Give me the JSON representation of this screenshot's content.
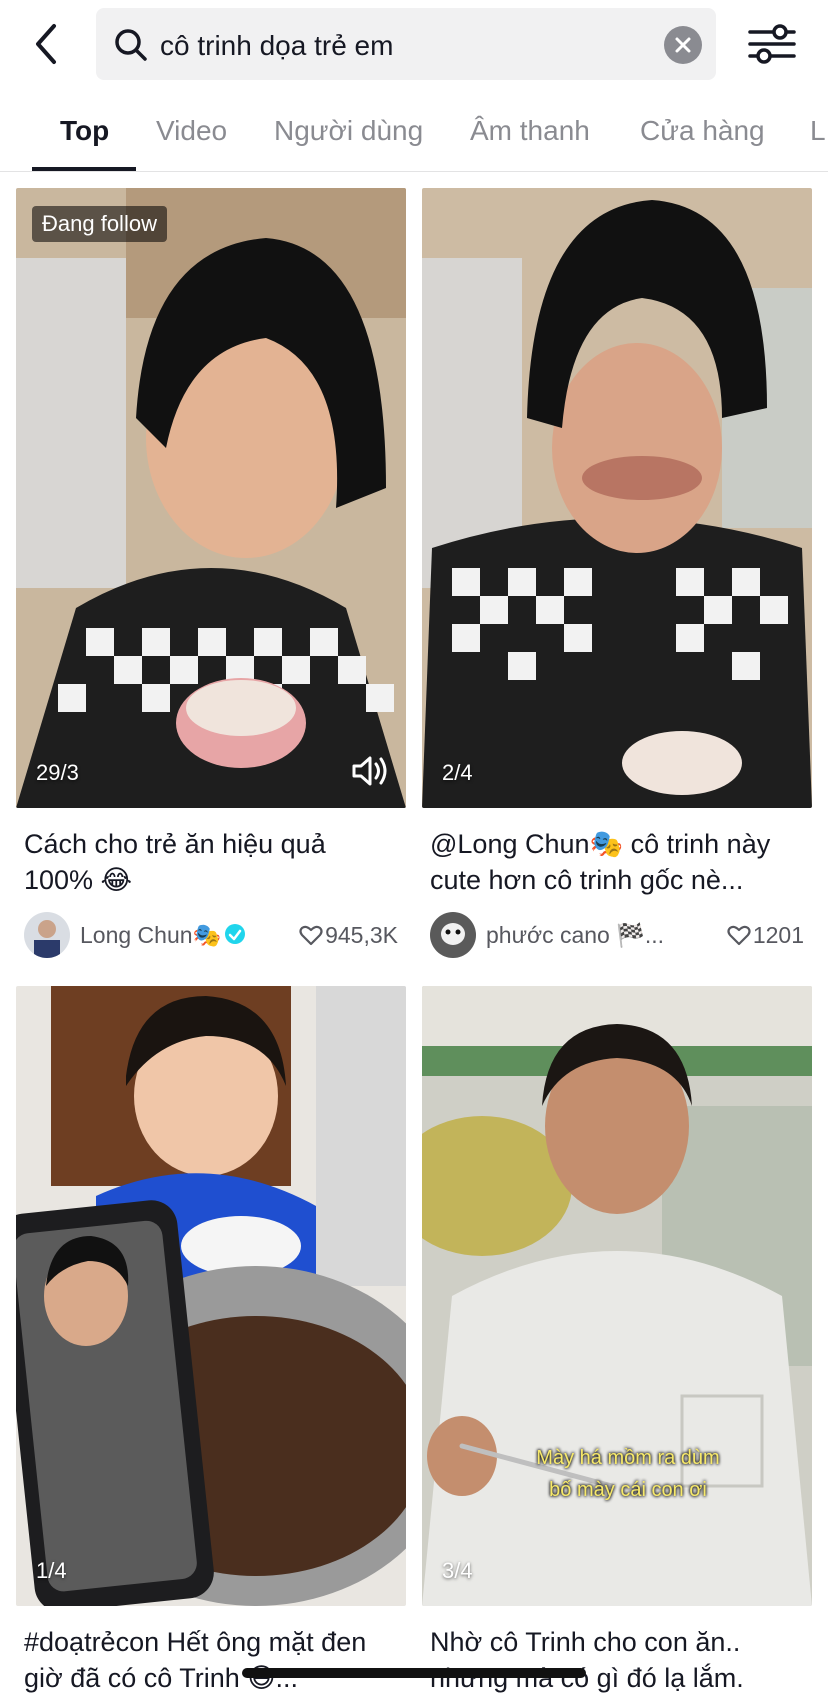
{
  "search": {
    "query": "cô trinh dọa trẻ em"
  },
  "tabs": [
    {
      "label": "Top"
    },
    {
      "label": "Video"
    },
    {
      "label": "Người dùng"
    },
    {
      "label": "Âm thanh"
    },
    {
      "label": "Cửa hàng"
    },
    {
      "label": "L"
    }
  ],
  "colors": {
    "accent": "#161823",
    "muted": "#8a8b91",
    "verified": "#20d5ec"
  },
  "videos": [
    {
      "badge": "Đang follow",
      "count": "29/3",
      "caption": "Cách cho trẻ ăn hiệu quả 100% 😂",
      "author": "Long Chun🎭",
      "verified": true,
      "likes": "945,3K",
      "icons": [
        "sound-icon",
        "heart-icon",
        "verified-icon"
      ]
    },
    {
      "count": "2/4",
      "caption": "@Long Chun🎭 cô trinh này cute hơn cô trinh gốc nè...",
      "author": "phước cano 🏁...",
      "likes": "1201"
    },
    {
      "count": "1/4",
      "caption": "#doạtrẻcon Hết ông mặt đen giờ đã có cô Trinh 😅..."
    },
    {
      "count": "3/4",
      "overlay_line1": "Mày há mồm ra dùm",
      "overlay_line2": "bố mày cái con ơi",
      "caption": "Nhờ cô Trinh cho con ăn.. nhưng mà có gì đó lạ lắm."
    }
  ]
}
